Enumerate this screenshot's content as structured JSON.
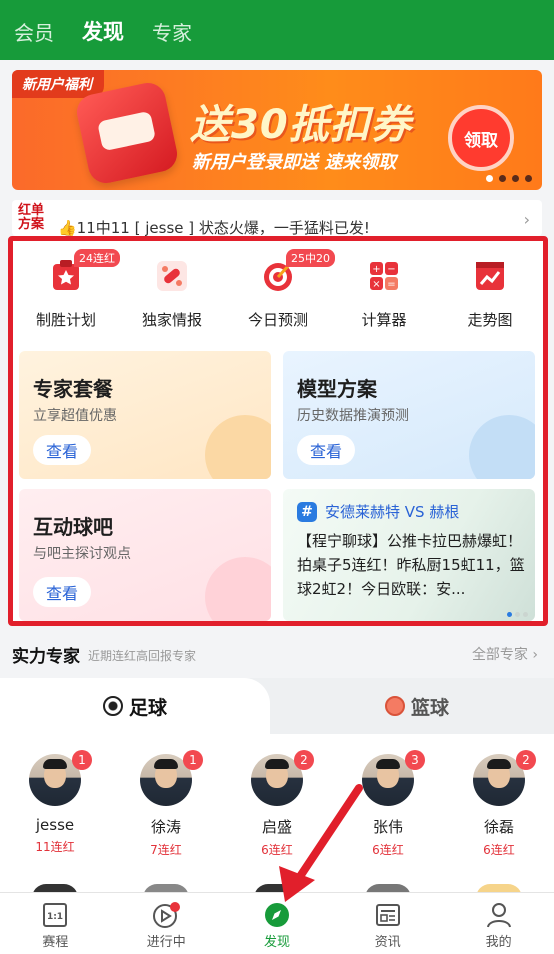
{
  "top_tabs": [
    "会员",
    "发现",
    "专家"
  ],
  "banner": {
    "tag": "新用户福利",
    "headline": "送30抵扣券",
    "subline": "新用户登录即送 速来领取",
    "claim_label": "领取"
  },
  "ticker": {
    "label_line1": "红单",
    "label_line2": "方案",
    "message": "👍11中11 [ jesse ] 状态火爆，一手猛料已发!"
  },
  "quick_icons": [
    {
      "label": "制胜计划",
      "badge": "24连红",
      "icon": "trophy-icon"
    },
    {
      "label": "独家情报",
      "badge": "",
      "icon": "exclusive-news-icon"
    },
    {
      "label": "今日预测",
      "badge": "25中20",
      "icon": "target-icon"
    },
    {
      "label": "计算器",
      "badge": "",
      "icon": "calculator-icon"
    },
    {
      "label": "走势图",
      "badge": "",
      "icon": "trend-chart-icon"
    }
  ],
  "cards": {
    "expert_package": {
      "title": "专家套餐",
      "subtitle": "立享超值优惠",
      "button": "查看"
    },
    "model_plan": {
      "title": "模型方案",
      "subtitle": "历史数据推演预测",
      "button": "查看"
    },
    "community": {
      "title": "互动球吧",
      "subtitle": "与吧主探讨观点",
      "button": "查看"
    },
    "match_post": {
      "hash": "#",
      "match": "安德莱赫特 VS 赫根",
      "body": "【程宁聊球】公推卡拉巴赫爆虹！拍桌子5连红！昨私厨15虹11，篮球2虹2！今日欧联：安..."
    }
  },
  "experts_section": {
    "title": "实力专家",
    "subtitle": "近期连红高回报专家",
    "all_link": "全部专家",
    "tab_football": "足球",
    "tab_basketball": "篮球",
    "experts": [
      {
        "name": "jesse",
        "streak": "11连红",
        "badge": "1"
      },
      {
        "name": "徐涛",
        "streak": "7连红",
        "badge": "1"
      },
      {
        "name": "启盛",
        "streak": "6连红",
        "badge": "2"
      },
      {
        "name": "张伟",
        "streak": "6连红",
        "badge": "3"
      },
      {
        "name": "徐磊",
        "streak": "6连红",
        "badge": "2"
      }
    ]
  },
  "bottom_nav": [
    "赛程",
    "进行中",
    "发现",
    "资讯",
    "我的"
  ],
  "colors": {
    "brand_green": "#179b3a",
    "highlight_red": "#e11f2b",
    "badge_red": "#f24950"
  }
}
